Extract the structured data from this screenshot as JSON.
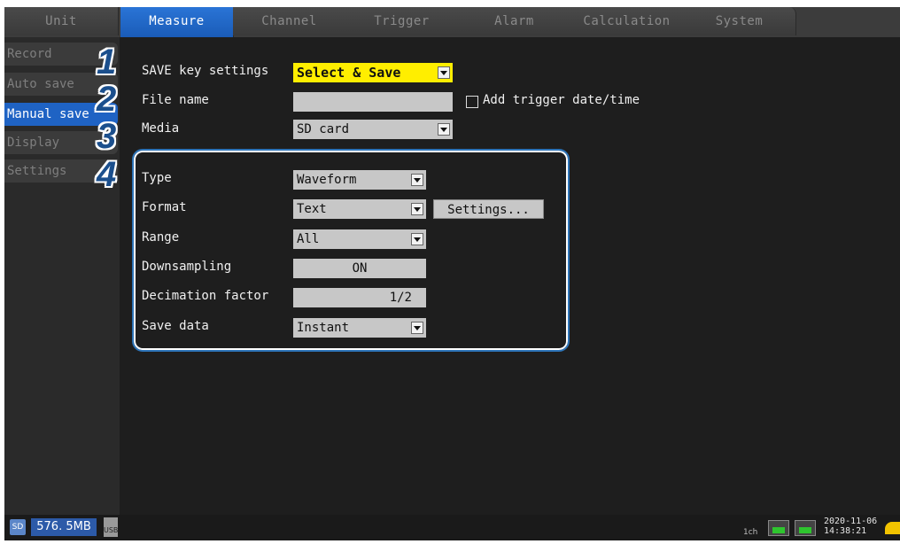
{
  "tabs": [
    "Unit",
    "Measure",
    "Channel",
    "Trigger",
    "Alarm",
    "Calculation",
    "System"
  ],
  "active_tab": "Measure",
  "submenu": [
    "Record",
    "Auto save",
    "Manual save",
    "Display",
    "Settings"
  ],
  "active_submenu": "Manual save",
  "settings": {
    "save_key_label": "SAVE key settings",
    "save_key_value": "Select & Save",
    "file_name_label": "File name",
    "file_name_value": "",
    "add_trigger_label": "Add trigger date/time",
    "media_label": "Media",
    "media_value": "SD card"
  },
  "group": {
    "type_label": "Type",
    "type_value": "Waveform",
    "format_label": "Format",
    "format_value": "Text",
    "settings_button": "Settings...",
    "range_label": "Range",
    "range_value": "All",
    "downsampling_label": "Downsampling",
    "downsampling_value": "ON",
    "decimation_label": "Decimation factor",
    "decimation_value": "1/2",
    "save_data_label": "Save data",
    "save_data_value": "Instant"
  },
  "callouts": [
    "1",
    "2",
    "3",
    "4"
  ],
  "status": {
    "sd_label": "SD",
    "memory": "576. 5MB",
    "usb_label": "USB",
    "channel_label": "1ch",
    "date": "2020-11-06",
    "time": "14:38:21"
  },
  "colors": {
    "active_tab": "#1a5cb8",
    "highlight_field": "#ffee00",
    "callout": "#1b4f8d",
    "group_border": "#2d74b8"
  }
}
